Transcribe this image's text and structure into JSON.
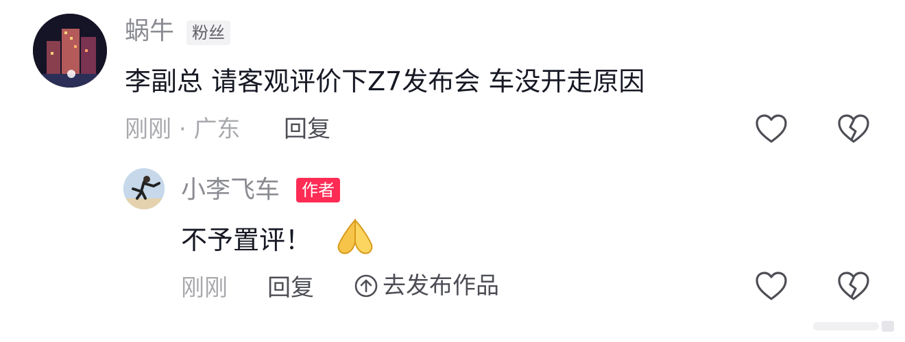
{
  "comment": {
    "username": "蜗牛",
    "badge": "粉丝",
    "text": "李副总 请客观评价下Z7发布会 车没开走原因",
    "time": "刚刚",
    "separator": "·",
    "location": "广东",
    "reply_label": "回复"
  },
  "reply": {
    "username": "小李飞车",
    "badge": "作者",
    "text": "不予置评！",
    "time": "刚刚",
    "reply_label": "回复",
    "publish_label": "去发布作品"
  },
  "colors": {
    "author_badge": "#fe2c55",
    "fan_badge_bg": "#f2f2f4",
    "muted_text": "#a8a9ad",
    "name_text": "#8a8b91"
  }
}
